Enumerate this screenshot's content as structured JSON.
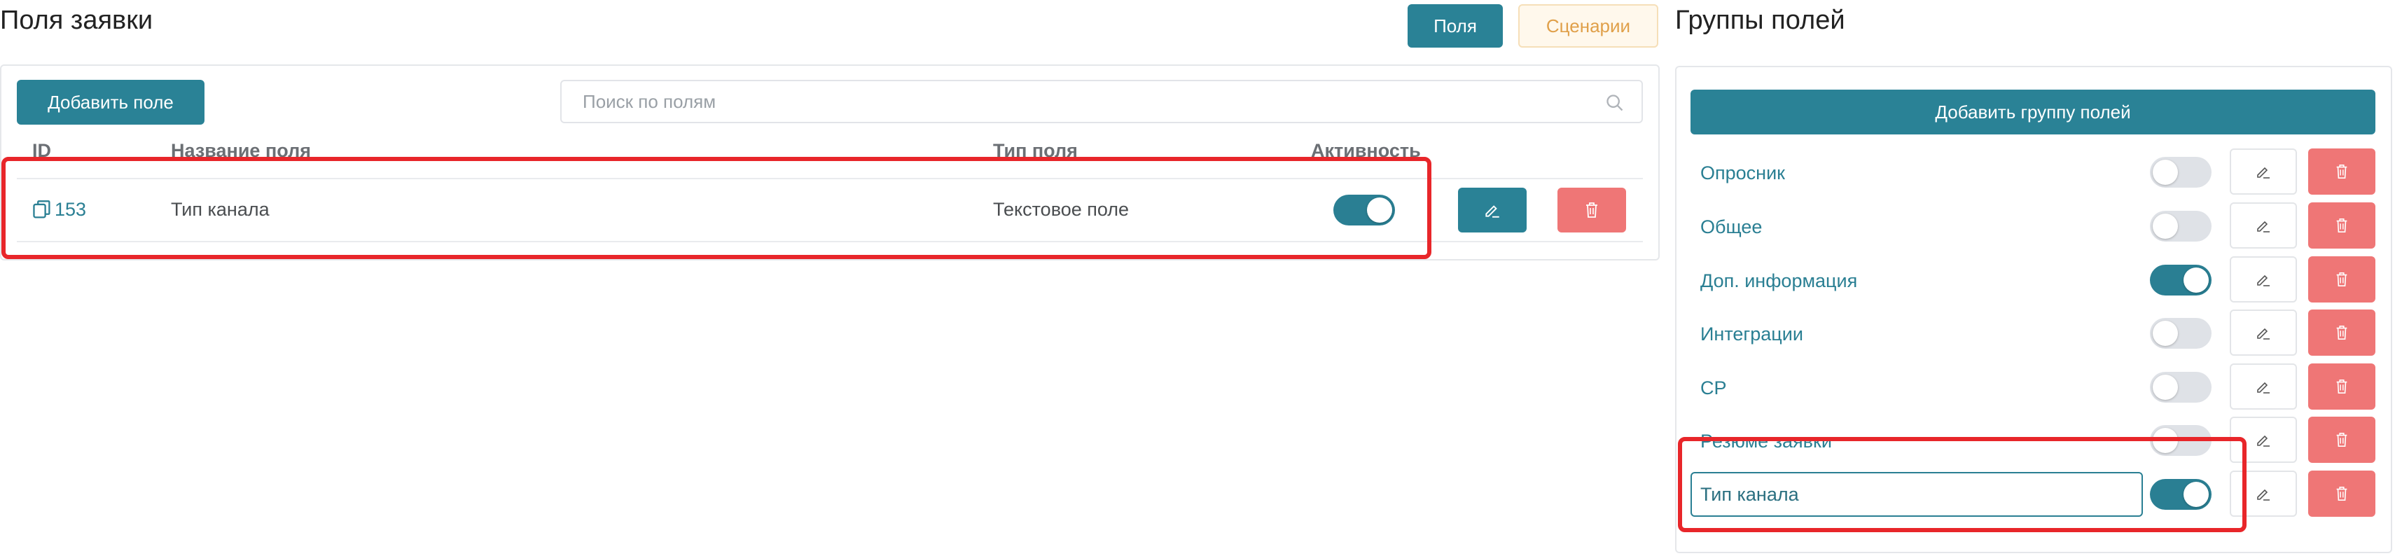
{
  "left": {
    "title": "Поля заявки",
    "tabs": [
      {
        "label": "Поля",
        "active": true
      },
      {
        "label": "Сценарии",
        "active": false
      }
    ],
    "add_field_label": "Добавить поле",
    "search_placeholder": "Поиск по полям",
    "columns": [
      "ID",
      "Название поля",
      "Тип поля",
      "Активность"
    ],
    "rows": [
      {
        "id": "153",
        "name": "Тип канала",
        "type": "Текстовое поле",
        "active": true
      }
    ]
  },
  "right": {
    "title": "Группы полей",
    "add_group_label": "Добавить группу полей",
    "groups": [
      {
        "label": "Опросник",
        "active": false
      },
      {
        "label": "Общее",
        "active": false
      },
      {
        "label": "Доп. информация",
        "active": true
      },
      {
        "label": "Интеграции",
        "active": false
      },
      {
        "label": "CP",
        "active": false
      },
      {
        "label": "Резюме заявки",
        "active": false
      },
      {
        "label": "Тип канала",
        "active": true,
        "editing": true
      }
    ]
  },
  "colors": {
    "primary": "#2a8296",
    "danger": "#ef7676",
    "highlight": "#e8262a",
    "warning": "#e0a04a"
  }
}
